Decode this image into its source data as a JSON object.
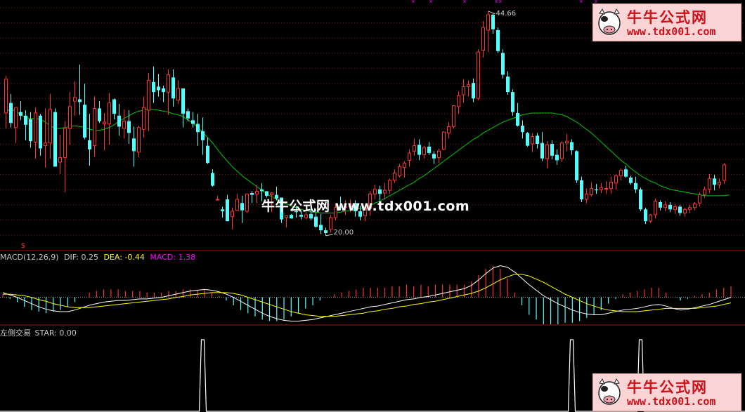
{
  "watermark": {
    "center_text": "牛牛公式网 www.tdx001.com",
    "logo_title": "牛牛公式网",
    "logo_url": "www.tdx001.com"
  },
  "colors": {
    "up": "#ff3232",
    "down": "#54ffff",
    "ma": "#00c800",
    "grid": "#8b1a1a",
    "dif": "#ffffff",
    "dea": "#ffff00",
    "macd_label": "#ff00ff",
    "star": "#ffffff"
  },
  "chart_data": [
    {
      "type": "candlestick",
      "panel": "price",
      "ylim": [
        19.3,
        45.3
      ],
      "annotations": {
        "high_label": "44.66",
        "low_label": "20.00"
      },
      "ohlc": [
        [
          33.5,
          37.6,
          31.8,
          37.2
        ],
        [
          34.6,
          35.6,
          31.9,
          32.4
        ],
        [
          31.9,
          34.1,
          30.2,
          34.1
        ],
        [
          33.6,
          34.8,
          32.7,
          33.2
        ],
        [
          33.2,
          33.8,
          30.5,
          32.2
        ],
        [
          32.8,
          33.6,
          29.7,
          30.4
        ],
        [
          30.3,
          34.1,
          28.5,
          33.5
        ],
        [
          33.2,
          33.4,
          28.8,
          29.6
        ],
        [
          29.9,
          34.0,
          27.5,
          30.2
        ],
        [
          30.2,
          35.6,
          28.5,
          33.9
        ],
        [
          33.6,
          34.0,
          27.6,
          27.6
        ],
        [
          28.1,
          31.1,
          26.8,
          28.6
        ],
        [
          28.6,
          32.6,
          24.8,
          31.8
        ],
        [
          31.8,
          35.8,
          30.0,
          34.2
        ],
        [
          34.8,
          37.0,
          33.2,
          35.2
        ],
        [
          35.0,
          38.8,
          33.3,
          34.7
        ],
        [
          34.4,
          36.7,
          30.6,
          30.8
        ],
        [
          30.5,
          33.4,
          27.7,
          29.5
        ],
        [
          29.9,
          35.3,
          28.7,
          34.0
        ],
        [
          34.0,
          34.8,
          32.4,
          32.6
        ],
        [
          32.3,
          33.5,
          29.4,
          32.5
        ],
        [
          32.3,
          35.7,
          30.0,
          34.6
        ],
        [
          35.0,
          35.1,
          32.8,
          33.4
        ],
        [
          33.2,
          34.5,
          31.0,
          32.0
        ],
        [
          31.8,
          33.9,
          30.7,
          32.6
        ],
        [
          32.6,
          33.8,
          30.1,
          31.3
        ],
        [
          30.7,
          32.0,
          27.6,
          29.3
        ],
        [
          29.2,
          32.1,
          28.6,
          31.9
        ],
        [
          31.7,
          35.3,
          30.8,
          34.1
        ],
        [
          33.8,
          37.9,
          31.5,
          37.1
        ],
        [
          36.9,
          38.6,
          34.6,
          35.8
        ],
        [
          36.4,
          37.8,
          35.3,
          36.0
        ],
        [
          36.2,
          36.5,
          34.7,
          35.8
        ],
        [
          35.8,
          38.3,
          33.3,
          37.7
        ],
        [
          37.4,
          38.3,
          34.2,
          35.1
        ],
        [
          34.9,
          37.1,
          34.5,
          36.2
        ],
        [
          36.2,
          36.2,
          31.9,
          33.4
        ],
        [
          33.7,
          34.0,
          32.6,
          32.9
        ],
        [
          32.7,
          33.6,
          31.9,
          32.3
        ],
        [
          32.3,
          33.4,
          29.9,
          31.4
        ],
        [
          31.5,
          33.0,
          28.9,
          30.5
        ],
        [
          29.9,
          30.8,
          27.9,
          28.0
        ],
        [
          26.9,
          27.3,
          25.4,
          25.5
        ],
        [
          24.0,
          24.4,
          24.0,
          24.0
        ],
        [
          22.9,
          23.2,
          22.0,
          22.7
        ],
        [
          24.0,
          24.5,
          21.6,
          21.6
        ],
        [
          22.1,
          23.1,
          20.7,
          22.7
        ],
        [
          22.8,
          24.6,
          22.8,
          24.0
        ],
        [
          23.6,
          24.4,
          21.4,
          22.8
        ],
        [
          22.7,
          24.6,
          22.5,
          24.6
        ],
        [
          24.7,
          24.9,
          23.6,
          24.5
        ],
        [
          24.6,
          25.6,
          23.6,
          24.9
        ],
        [
          25.1,
          25.8,
          23.8,
          24.9
        ],
        [
          24.9,
          24.9,
          24.2,
          24.4
        ],
        [
          24.5,
          24.8,
          22.6,
          24.7
        ],
        [
          24.5,
          25.4,
          23.9,
          24.1
        ],
        [
          24.2,
          24.2,
          21.4,
          21.8
        ],
        [
          22.0,
          22.2,
          20.9,
          22.2
        ],
        [
          22.3,
          22.4,
          21.9,
          21.9
        ],
        [
          22.7,
          23.3,
          22.0,
          22.6
        ],
        [
          22.3,
          22.7,
          21.8,
          22.1
        ],
        [
          22.0,
          22.6,
          21.8,
          22.3
        ],
        [
          22.4,
          23.2,
          21.7,
          21.9
        ],
        [
          22.1,
          22.9,
          20.9,
          21.0
        ],
        [
          21.2,
          22.4,
          20.2,
          20.6
        ],
        [
          20.6,
          20.9,
          20.0,
          20.3
        ],
        [
          20.7,
          22.3,
          20.4,
          22.0
        ],
        [
          22.0,
          23.5,
          21.7,
          23.1
        ],
        [
          23.2,
          24.3,
          22.8,
          23.1
        ],
        [
          23.1,
          23.9,
          22.3,
          23.2
        ],
        [
          23.2,
          24.0,
          22.6,
          23.5
        ],
        [
          23.6,
          23.9,
          22.1,
          22.7
        ],
        [
          22.7,
          23.3,
          21.7,
          22.1
        ],
        [
          22.2,
          23.4,
          21.6,
          23.1
        ],
        [
          23.0,
          24.9,
          22.2,
          24.6
        ],
        [
          24.6,
          25.6,
          24.0,
          25.1
        ],
        [
          25.1,
          25.5,
          23.9,
          24.6
        ],
        [
          24.7,
          25.8,
          24.0,
          25.0
        ],
        [
          25.0,
          26.3,
          24.6,
          26.1
        ],
        [
          26.1,
          27.3,
          25.8,
          26.9
        ],
        [
          26.6,
          27.9,
          26.4,
          27.6
        ],
        [
          27.5,
          28.2,
          26.4,
          28.0
        ],
        [
          28.3,
          29.5,
          27.6,
          29.1
        ],
        [
          29.3,
          30.7,
          28.8,
          29.9
        ],
        [
          30.0,
          30.6,
          28.3,
          28.9
        ],
        [
          28.9,
          29.9,
          28.5,
          29.7
        ],
        [
          29.8,
          30.3,
          28.9,
          29.1
        ],
        [
          29.0,
          29.3,
          27.9,
          28.5
        ],
        [
          28.6,
          29.6,
          28.0,
          29.3
        ],
        [
          29.5,
          31.5,
          29.4,
          31.4
        ],
        [
          31.3,
          32.5,
          30.7,
          32.0
        ],
        [
          32.0,
          34.3,
          31.8,
          34.3
        ],
        [
          34.2,
          35.9,
          33.4,
          35.4
        ],
        [
          35.5,
          37.2,
          34.6,
          36.4
        ],
        [
          36.4,
          37.1,
          35.3,
          36.6
        ],
        [
          36.8,
          37.3,
          34.7,
          35.1
        ],
        [
          35.1,
          40.5,
          34.9,
          40.2
        ],
        [
          40.4,
          43.6,
          39.6,
          42.9
        ],
        [
          42.6,
          44.7,
          40.2,
          44.3
        ],
        [
          44.3,
          44.4,
          42.2,
          42.7
        ],
        [
          42.6,
          42.9,
          40.1,
          40.3
        ],
        [
          40.1,
          40.5,
          37.3,
          37.7
        ],
        [
          37.5,
          38.1,
          35.5,
          35.8
        ],
        [
          35.8,
          36.1,
          33.2,
          33.6
        ],
        [
          33.5,
          34.6,
          32.0,
          32.1
        ],
        [
          32.1,
          32.7,
          30.7,
          31.4
        ],
        [
          31.3,
          31.4,
          29.8,
          29.9
        ],
        [
          30.1,
          31.3,
          29.2,
          30.9
        ],
        [
          31.0,
          31.3,
          29.6,
          30.1
        ],
        [
          30.2,
          31.4,
          28.2,
          28.5
        ],
        [
          28.5,
          30.4,
          27.4,
          30.0
        ],
        [
          30.1,
          30.5,
          28.4,
          28.8
        ],
        [
          28.9,
          29.5,
          27.8,
          28.3
        ],
        [
          28.5,
          30.4,
          28.1,
          30.2
        ],
        [
          30.2,
          31.2,
          29.3,
          30.4
        ],
        [
          30.3,
          30.6,
          28.9,
          29.4
        ],
        [
          29.3,
          29.4,
          25.8,
          26.1
        ],
        [
          26.1,
          26.5,
          23.7,
          24.0
        ],
        [
          24.0,
          25.2,
          23.6,
          24.6
        ],
        [
          24.5,
          25.9,
          24.3,
          25.2
        ],
        [
          25.1,
          25.7,
          24.6,
          25.0
        ],
        [
          25.1,
          25.8,
          24.7,
          25.3
        ],
        [
          25.2,
          26.0,
          24.6,
          25.2
        ],
        [
          25.2,
          26.5,
          24.6,
          25.9
        ],
        [
          25.8,
          26.8,
          25.1,
          26.6
        ],
        [
          26.6,
          27.4,
          26.1,
          27.2
        ],
        [
          27.3,
          27.7,
          26.4,
          26.5
        ],
        [
          26.4,
          26.6,
          25.6,
          25.8
        ],
        [
          25.8,
          26.5,
          24.7,
          25.1
        ],
        [
          25.1,
          25.3,
          22.7,
          22.9
        ],
        [
          22.9,
          23.1,
          21.3,
          21.6
        ],
        [
          21.6,
          22.4,
          21.4,
          22.3
        ],
        [
          22.3,
          24.1,
          21.9,
          23.8
        ],
        [
          23.7,
          23.9,
          22.8,
          23.1
        ],
        [
          23.1,
          23.8,
          22.7,
          23.4
        ],
        [
          23.4,
          23.7,
          22.6,
          22.9
        ],
        [
          22.9,
          23.5,
          22.4,
          23.2
        ],
        [
          23.2,
          23.4,
          22.2,
          22.5
        ],
        [
          22.5,
          23.1,
          22.1,
          22.9
        ],
        [
          22.9,
          23.4,
          22.5,
          23.1
        ],
        [
          23.1,
          23.7,
          22.8,
          23.5
        ],
        [
          23.6,
          24.8,
          23.2,
          24.5
        ],
        [
          24.5,
          25.4,
          24.2,
          25.1
        ],
        [
          25.1,
          26.8,
          24.7,
          26.3
        ],
        [
          26.3,
          26.7,
          25.0,
          25.6
        ],
        [
          25.6,
          26.3,
          25.2,
          25.9
        ],
        [
          26.1,
          28.0,
          25.7,
          27.8
        ]
      ],
      "ma_line": [
        33.7,
        33.9,
        33.7,
        33.3,
        33.0,
        32.9,
        32.9,
        32.8,
        32.5,
        32.1,
        31.8,
        31.8,
        31.9,
        32.0,
        32.1,
        32.0,
        31.9,
        31.7,
        31.6,
        31.6,
        31.7,
        31.9,
        32.2,
        32.6,
        32.9,
        33.2,
        33.5,
        33.7,
        33.8,
        33.9,
        33.9,
        33.8,
        33.7,
        33.6,
        33.4,
        33.3,
        33.1,
        32.7,
        32.4,
        31.9,
        31.4,
        30.8,
        30.2,
        29.5,
        28.8,
        28.2,
        27.6,
        27.1,
        26.6,
        26.2,
        25.8,
        25.4,
        25.0,
        24.6,
        24.3,
        24.0,
        23.7,
        23.5,
        23.3,
        23.1,
        22.9,
        22.8,
        22.6,
        22.6,
        22.5,
        22.5,
        22.5,
        22.5,
        22.6,
        22.7,
        22.8,
        22.9,
        23.0,
        23.2,
        23.3,
        23.6,
        23.8,
        24.1,
        24.4,
        24.7,
        25.0,
        25.3,
        25.6,
        25.9,
        26.3,
        26.6,
        27.0,
        27.4,
        27.8,
        28.2,
        28.6,
        29.0,
        29.4,
        29.8,
        30.2,
        30.6,
        30.9,
        31.3,
        31.6,
        31.9,
        32.2,
        32.5,
        32.7,
        32.9,
        33.1,
        33.3,
        33.4,
        33.5,
        33.5,
        33.5,
        33.5,
        33.5,
        33.4,
        33.3,
        33.1,
        32.8,
        32.5,
        32.1,
        31.7,
        31.3,
        30.8,
        30.3,
        29.8,
        29.3,
        28.8,
        28.3,
        27.9,
        27.4,
        27.0,
        26.6,
        26.3,
        26.0,
        25.8,
        25.5,
        25.3,
        25.1,
        25.0,
        24.9,
        24.8,
        24.7,
        24.6,
        24.5,
        24.4,
        24.4,
        24.4,
        24.4,
        24.4,
        24.5
      ]
    },
    {
      "type": "bar_line",
      "panel": "MACD",
      "title": "MACD(12,26,9)",
      "legend": [
        {
          "name": "DIF",
          "value": "0.25"
        },
        {
          "name": "DEA",
          "value": "-0.44"
        },
        {
          "name": "MACD",
          "value": "1.38"
        }
      ],
      "ylim": [
        -3.4,
        4.4
      ],
      "dif": [
        0.6,
        0.3,
        0.0,
        -0.4,
        -0.8,
        -1.2,
        -1.5,
        -1.7,
        -1.8,
        -1.8,
        -1.6,
        -1.3,
        -1.0,
        -0.8,
        -0.6,
        -0.5,
        -0.4,
        -0.4,
        -0.3,
        -0.2,
        -0.2,
        -0.1,
        0.0,
        0.2,
        0.4,
        0.6,
        0.8,
        0.9,
        1.0,
        0.9,
        0.7,
        0.4,
        0.0,
        -0.5,
        -1.0,
        -1.5,
        -2.0,
        -2.4,
        -2.7,
        -2.9,
        -3.0,
        -3.0,
        -2.9,
        -2.8,
        -2.6,
        -2.4,
        -2.2,
        -2.0,
        -1.8,
        -1.6,
        -1.4,
        -1.2,
        -1.1,
        -0.9,
        -0.7,
        -0.5,
        -0.3,
        -0.2,
        0.0,
        0.1,
        0.3,
        0.5,
        0.7,
        0.9,
        1.1,
        1.5,
        2.2,
        3.0,
        3.7,
        4.0,
        3.8,
        3.2,
        2.4,
        1.6,
        0.9,
        0.2,
        -0.3,
        -0.8,
        -1.2,
        -1.6,
        -1.9,
        -2.1,
        -2.2,
        -2.2,
        -2.0,
        -1.8,
        -1.6,
        -1.5,
        -1.4,
        -1.2,
        -1.0,
        -0.9,
        -1.1,
        -1.4,
        -1.6,
        -1.5,
        -1.3,
        -1.1,
        -0.9,
        -0.6,
        -0.3,
        0.0
      ],
      "dea": [
        0.4,
        0.4,
        0.3,
        0.2,
        0.0,
        -0.3,
        -0.5,
        -0.8,
        -1.0,
        -1.2,
        -1.3,
        -1.3,
        -1.3,
        -1.2,
        -1.1,
        -1.0,
        -0.9,
        -0.8,
        -0.7,
        -0.6,
        -0.5,
        -0.4,
        -0.3,
        -0.2,
        0.0,
        0.1,
        0.3,
        0.4,
        0.5,
        0.6,
        0.6,
        0.6,
        0.5,
        0.3,
        0.0,
        -0.3,
        -0.6,
        -0.9,
        -1.2,
        -1.5,
        -1.8,
        -2.0,
        -2.2,
        -2.3,
        -2.4,
        -2.4,
        -2.4,
        -2.3,
        -2.2,
        -2.1,
        -2.0,
        -1.8,
        -1.7,
        -1.5,
        -1.4,
        -1.2,
        -1.1,
        -0.9,
        -0.8,
        -0.6,
        -0.5,
        -0.3,
        -0.1,
        0.1,
        0.3,
        0.5,
        0.8,
        1.2,
        1.7,
        2.2,
        2.6,
        2.9,
        2.9,
        2.7,
        2.3,
        1.9,
        1.4,
        0.9,
        0.4,
        0.0,
        -0.4,
        -0.8,
        -1.1,
        -1.4,
        -1.6,
        -1.7,
        -1.8,
        -1.8,
        -1.8,
        -1.7,
        -1.6,
        -1.5,
        -1.4,
        -1.4,
        -1.4,
        -1.4,
        -1.4,
        -1.3,
        -1.2,
        -1.1,
        -0.9,
        -0.7
      ]
    },
    {
      "type": "line",
      "panel": "STAR",
      "title": "左侧交易",
      "legend": [
        {
          "name": "STAR",
          "value": "0.00"
        }
      ],
      "ylim": [
        0,
        1
      ],
      "signal_bars": [
        40,
        115,
        129
      ]
    }
  ]
}
